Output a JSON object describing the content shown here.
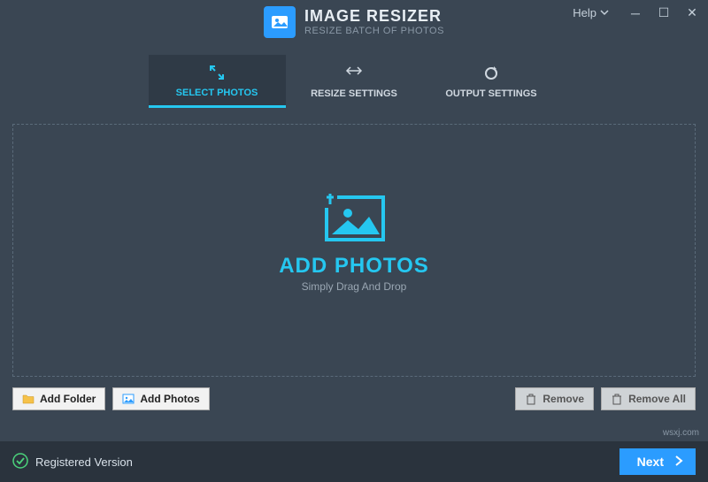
{
  "header": {
    "title": "IMAGE RESIZER",
    "subtitle": "RESIZE BATCH OF PHOTOS",
    "help_label": "Help"
  },
  "tabs": {
    "select": "SELECT PHOTOS",
    "resize": "RESIZE SETTINGS",
    "output": "OUTPUT SETTINGS"
  },
  "dropzone": {
    "title": "ADD PHOTOS",
    "subtitle": "Simply Drag And Drop"
  },
  "toolbar": {
    "add_folder": "Add Folder",
    "add_photos": "Add Photos",
    "remove": "Remove",
    "remove_all": "Remove All"
  },
  "footer": {
    "status": "Registered Version",
    "next": "Next"
  },
  "watermark": "wsxj.com"
}
